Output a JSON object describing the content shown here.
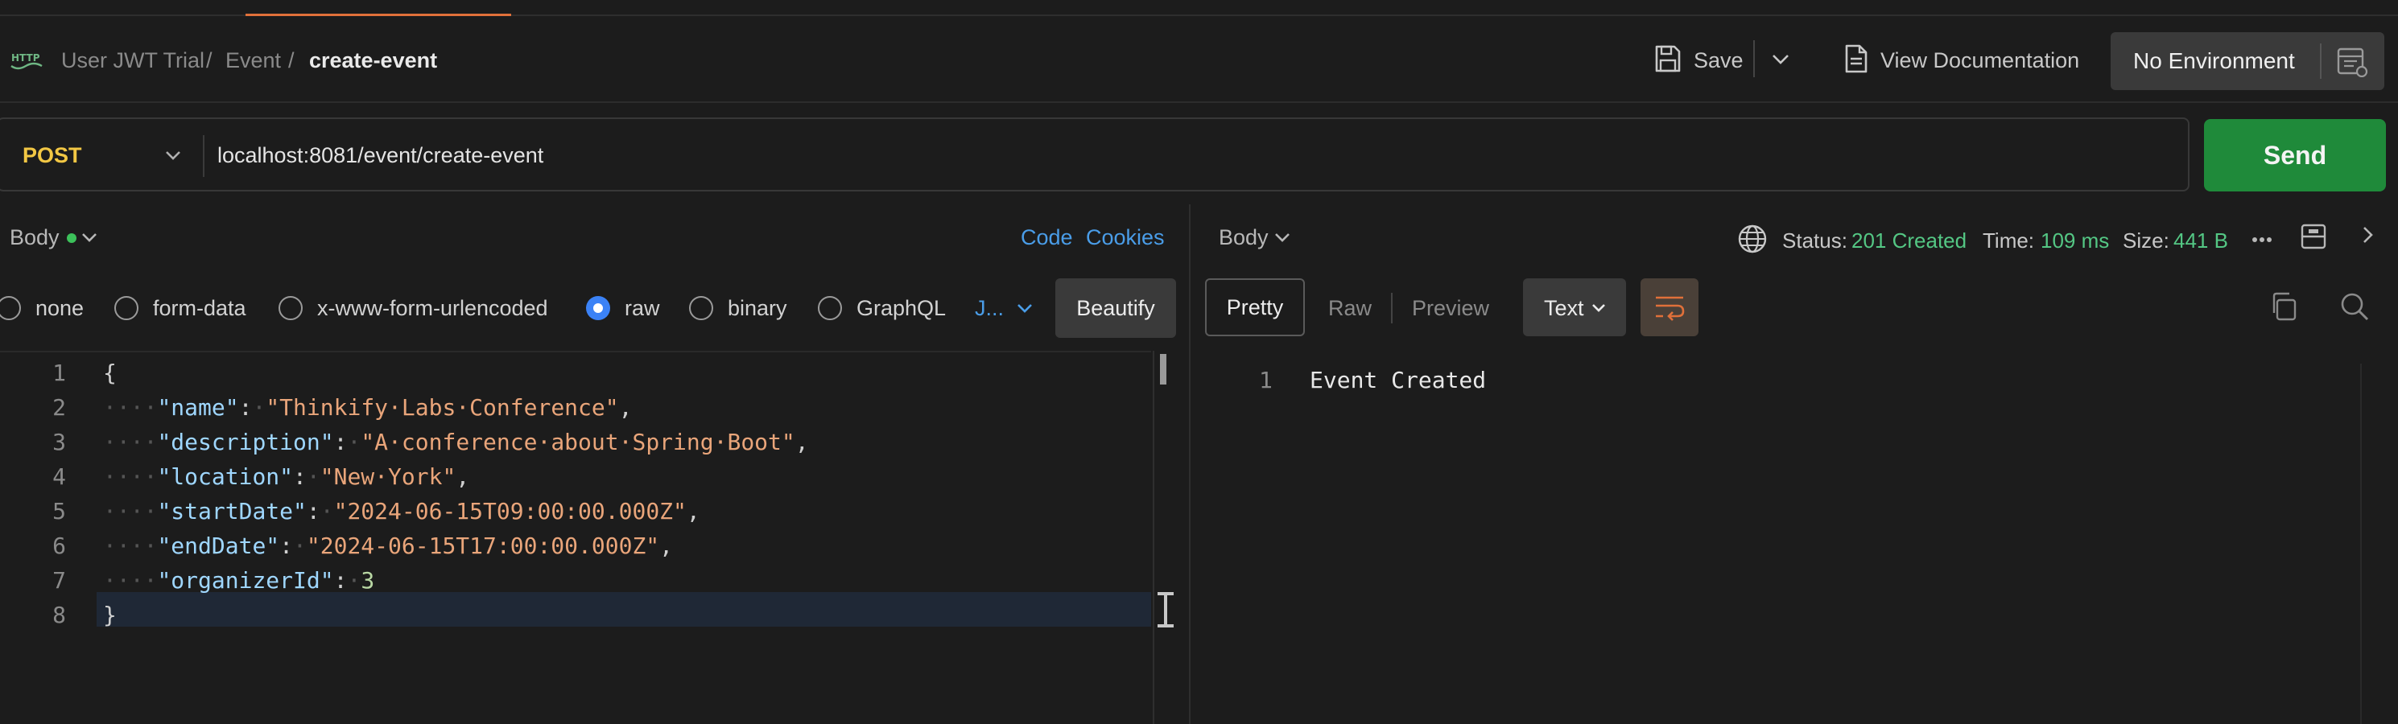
{
  "colors": {
    "accent_orange": "#e0703a",
    "method_yellow": "#f2c744",
    "send_green": "#1f8a3a",
    "status_green": "#54c784",
    "link_blue": "#4a9de8",
    "json_key": "#9fd7ff",
    "json_string": "#e9a57a",
    "json_number": "#b8d7a3"
  },
  "breadcrumb": {
    "collection": "User JWT Trial",
    "sep1": "/",
    "folder": "Event",
    "sep2": "/",
    "request": "create-event"
  },
  "header": {
    "save_label": "Save",
    "view_docs_label": "View Documentation",
    "environment_label": "No Environment"
  },
  "request": {
    "method": "POST",
    "url": "localhost:8081/event/create-event",
    "send_label": "Send"
  },
  "request_tabs": {
    "body_label": "Body",
    "code_link": "Code",
    "cookies_link": "Cookies"
  },
  "body_types": [
    {
      "label": "none",
      "selected": false
    },
    {
      "label": "form-data",
      "selected": false
    },
    {
      "label": "x-www-form-urlencoded",
      "selected": false
    },
    {
      "label": "raw",
      "selected": true
    },
    {
      "label": "binary",
      "selected": false
    },
    {
      "label": "GraphQL",
      "selected": false
    }
  ],
  "raw_format_label": "J...",
  "beautify_label": "Beautify",
  "editor": {
    "line_numbers": [
      "1",
      "2",
      "3",
      "4",
      "5",
      "6",
      "7",
      "8"
    ],
    "brace_open": "{",
    "brace_close": "}",
    "fields": [
      {
        "key": "\"name\"",
        "value": "\"Thinkify·Labs·Conference\"",
        "trail": ","
      },
      {
        "key": "\"description\"",
        "value": "\"A·conference·about·Spring·Boot\"",
        "trail": ","
      },
      {
        "key": "\"location\"",
        "value": "\"New·York\"",
        "trail": ","
      },
      {
        "key": "\"startDate\"",
        "value": "\"2024-06-15T09:00:00.000Z\"",
        "trail": ","
      },
      {
        "key": "\"endDate\"",
        "value": "\"2024-06-15T17:00:00.000Z\"",
        "trail": ","
      },
      {
        "key": "\"organizerId\"",
        "value": "3",
        "trail": ""
      }
    ],
    "indent": "····",
    "colon": ":",
    "space_dot": "·"
  },
  "response": {
    "body_label": "Body",
    "status_label": "Status:",
    "status_value": "201 Created",
    "time_label": "Time:",
    "time_value": "109 ms",
    "size_label": "Size:",
    "size_value": "441 B",
    "views": [
      "Pretty",
      "Raw",
      "Preview"
    ],
    "format_label": "Text",
    "line_number": "1",
    "content": "Event Created"
  }
}
